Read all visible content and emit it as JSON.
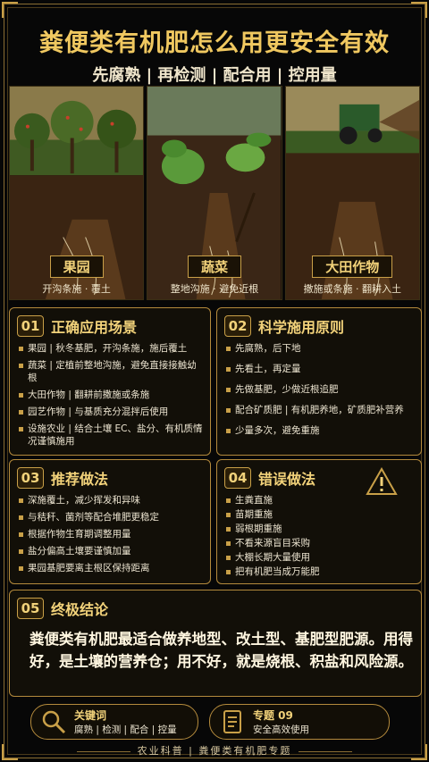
{
  "header": {
    "title": "粪便类有机肥怎么用更安全有效",
    "subtitle": "先腐熟 | 再检测 | 配合用 | 控用量"
  },
  "photos": [
    {
      "label": "果园",
      "caption": "开沟条施 · 覆土"
    },
    {
      "label": "蔬菜",
      "caption": "整地沟施 · 避免近根"
    },
    {
      "label": "大田作物",
      "caption": "撒施或条施 · 翻耕入土"
    }
  ],
  "sections": [
    {
      "num": "01",
      "title": "正确应用场景",
      "items": [
        "果园 | 秋冬基肥，开沟条施，施后覆土",
        "蔬菜 | 定植前整地沟施，避免直接接触幼根",
        "大田作物 | 翻耕前撒施或条施",
        "园艺作物 | 与基质充分混拌后使用",
        "设施农业 | 结合土壤 EC、盐分、有机质情况谨慎施用"
      ]
    },
    {
      "num": "02",
      "title": "科学施用原则",
      "items": [
        "先腐熟，后下地",
        "先看土，再定量",
        "先做基肥，少做近根追肥",
        "配合矿质肥 | 有机肥养地，矿质肥补营养",
        "少量多次，避免重施"
      ]
    },
    {
      "num": "03",
      "title": "推荐做法",
      "items": [
        "深施覆土，减少挥发和异味",
        "与秸秆、菌剂等配合堆肥更稳定",
        "根据作物生育期调整用量",
        "盐分偏高土壤要谨慎加量",
        "果园基肥要离主根区保持距离"
      ]
    },
    {
      "num": "04",
      "title": "错误做法",
      "items": [
        "生粪直施",
        "苗期重施",
        "弱根期重施",
        "不看来源盲目采购",
        "大棚长期大量使用",
        "把有机肥当成万能肥"
      ]
    }
  ],
  "conclusion": {
    "num": "05",
    "title": "终极结论",
    "text": "粪便类有机肥最适合做养地型、改土型、基肥型肥源。用得好，是土壤的营养仓；用不好，就是烧根、积盐和风险源。"
  },
  "pills": {
    "keywords_title": "关键词",
    "keywords_text": "腐熟 | 检测 | 配合 | 控量",
    "topic_title": "专题 09",
    "topic_text": "安全高效使用"
  },
  "footer": {
    "left": "农业科普",
    "right": "粪便类有机肥专题"
  },
  "colors": {
    "accent": "#f2d27a",
    "border": "#b48a3c",
    "background": "#070707"
  },
  "icons": [
    "search-icon",
    "document-icon",
    "warning-icon"
  ]
}
